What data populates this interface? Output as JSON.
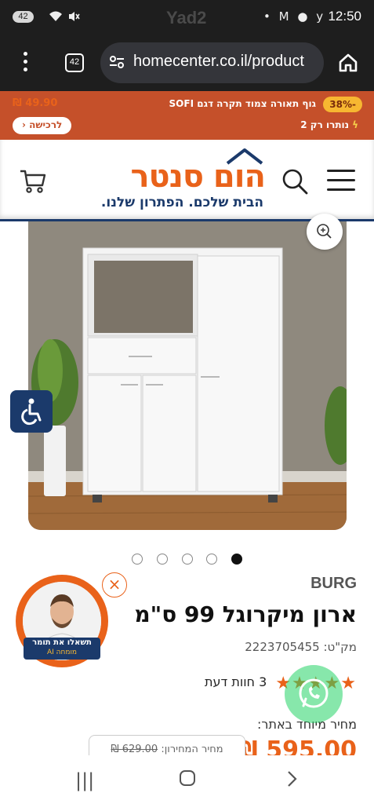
{
  "status_bar": {
    "battery": "42",
    "carrier": "Yad2",
    "time": "12:50",
    "icons": [
      "wifi-icon",
      "mute-icon",
      "dot-icon",
      "gmail-icon",
      "chat-icon",
      "signal-icon"
    ]
  },
  "browser": {
    "tab_count": "42",
    "url": "homecenter.co.il/product"
  },
  "promo": {
    "discount": "-38%",
    "product_name": "גוף תאורה צמוד תקרה דגם SOFI",
    "price": "₪ 49.90",
    "stock": "נותרו רק 2",
    "buy_label": "לרכישה"
  },
  "header": {
    "logo_text": "הום סנטר",
    "tagline": "הבית שלכם. הפתרון שלנו."
  },
  "gallery": {
    "slides": 5,
    "active_slide": 5
  },
  "product": {
    "brand": "BURG",
    "title": "ארון מיקרוגל 99 ס\"מ",
    "sku_label": "מק\"ט:",
    "sku": "2223705455",
    "stars": 5,
    "reviews": "3 חוות דעת",
    "store_price_label": "מחיר מיוחד באתר:",
    "price": "595.00 ₪",
    "club_price_label": "מחיר המחירון:",
    "old_price": "629.00 ₪"
  },
  "assistant": {
    "label": "תשאלו את תומר",
    "sublabel": "מומחה AI"
  },
  "colors": {
    "brand_orange": "#e9621a",
    "brand_navy": "#1b3a6b",
    "promo_bg": "#c5502a"
  }
}
